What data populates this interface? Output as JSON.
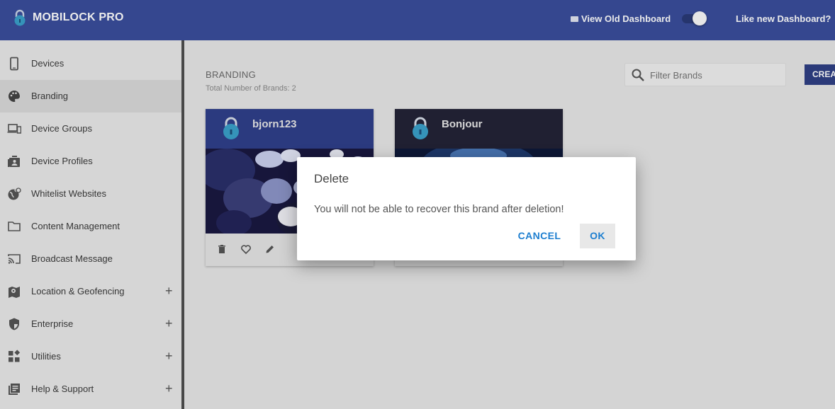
{
  "header": {
    "app_name": "MOBILOCK PRO",
    "view_old_dashboard": "View Old Dashboard",
    "like_new_dashboard": "Like new Dashboard?",
    "toggle_state": "on",
    "colors": {
      "bar": "#3a4e9c"
    }
  },
  "sidebar": {
    "items": [
      {
        "label": "Devices",
        "icon": "phone-icon",
        "active": false,
        "expandable": false
      },
      {
        "label": "Branding",
        "icon": "palette-icon",
        "active": true,
        "expandable": false
      },
      {
        "label": "Device Groups",
        "icon": "devices-icon",
        "active": false,
        "expandable": false
      },
      {
        "label": "Device Profiles",
        "icon": "profile-icon",
        "active": false,
        "expandable": false
      },
      {
        "label": "Whitelist Websites",
        "icon": "globe-icon",
        "active": false,
        "expandable": false
      },
      {
        "label": "Content Management",
        "icon": "folder-icon",
        "active": false,
        "expandable": false
      },
      {
        "label": "Broadcast Message",
        "icon": "cast-icon",
        "active": false,
        "expandable": false
      },
      {
        "label": "Location & Geofencing",
        "icon": "map-icon",
        "active": false,
        "expandable": true
      },
      {
        "label": "Enterprise",
        "icon": "shield-icon",
        "active": false,
        "expandable": true
      },
      {
        "label": "Utilities",
        "icon": "widgets-icon",
        "active": false,
        "expandable": true
      },
      {
        "label": "Help & Support",
        "icon": "library-icon",
        "active": false,
        "expandable": true
      }
    ],
    "expand_symbol": "+"
  },
  "main": {
    "title": "BRANDING",
    "count_text": "Total Number of Brands: 2",
    "search": {
      "placeholder": "Filter Brands",
      "value": ""
    },
    "create_label": "CREA",
    "cards": [
      {
        "name": "bjorn123",
        "header_color": "#2f3f8a"
      },
      {
        "name": "Bonjour",
        "header_color": "#232337"
      }
    ]
  },
  "dialog": {
    "title": "Delete",
    "message": "You will not be able to recover this brand after deletion!",
    "cancel_label": "CANCEL",
    "ok_label": "OK",
    "accent": "#1e7fd0"
  }
}
